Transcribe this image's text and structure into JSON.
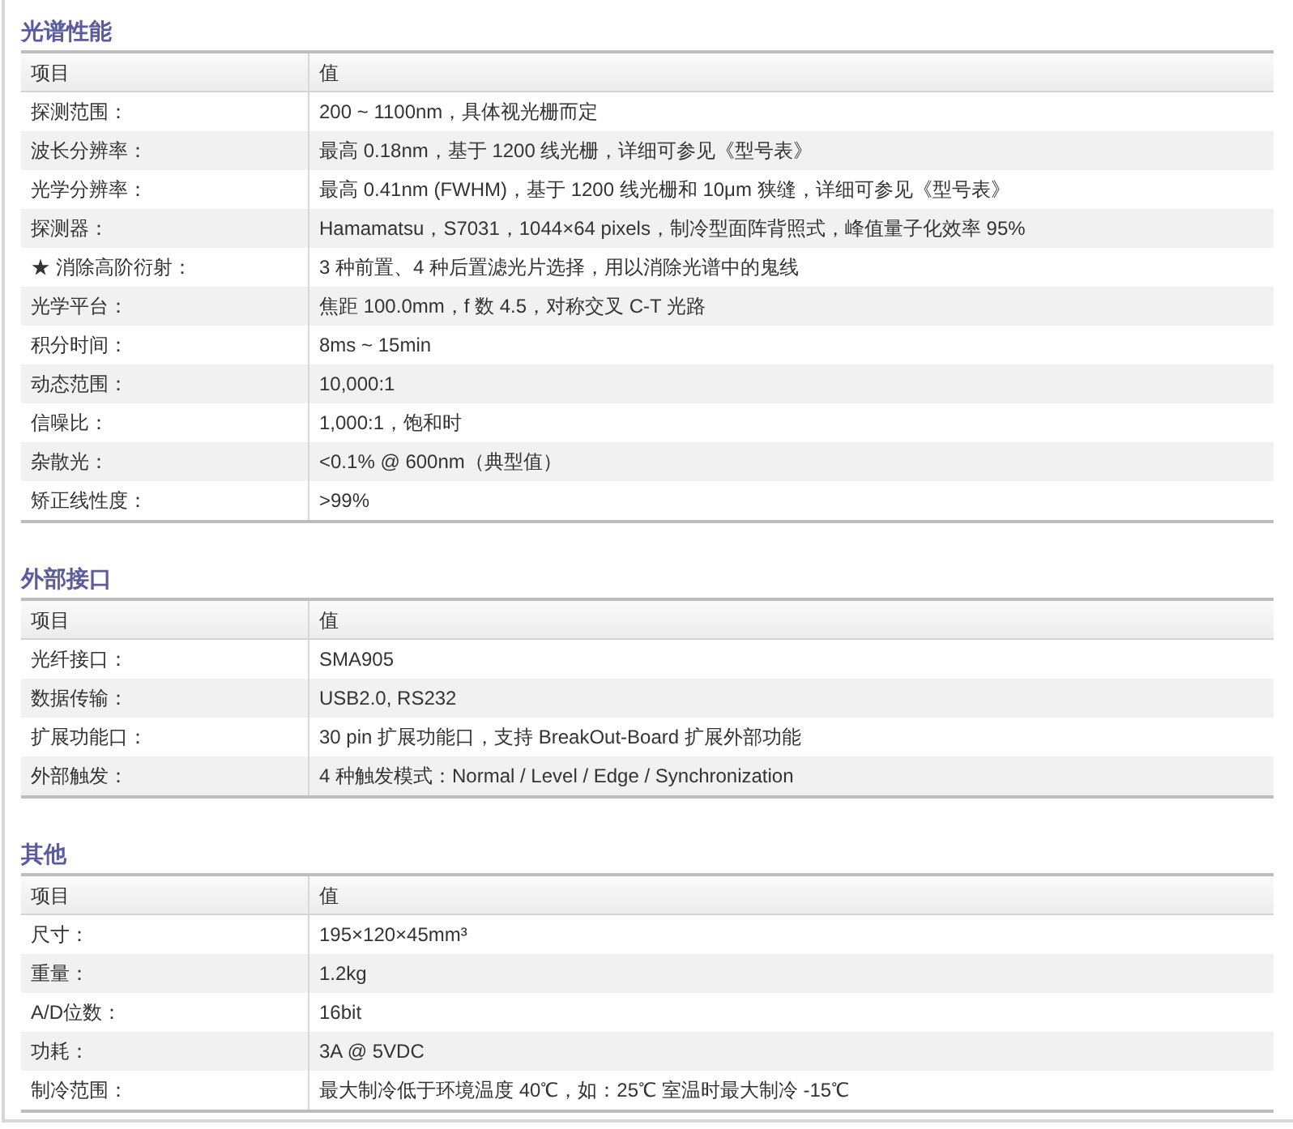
{
  "sections": [
    {
      "title": "光谱性能",
      "columns": [
        "项目",
        "值"
      ],
      "rows": [
        [
          "探测范围：",
          "200 ~ 1100nm，具体视光栅而定"
        ],
        [
          "波长分辨率：",
          "最高 0.18nm，基于 1200 线光栅，详细可参见《型号表》"
        ],
        [
          "光学分辨率：",
          "最高 0.41nm (FWHM)，基于 1200 线光栅和 10μm 狭缝，详细可参见《型号表》"
        ],
        [
          "探测器：",
          "Hamamatsu，S7031，1044×64 pixels，制冷型面阵背照式，峰值量子化效率 95%"
        ],
        [
          "★ 消除高阶衍射：",
          "3 种前置、4 种后置滤光片选择，用以消除光谱中的鬼线"
        ],
        [
          "光学平台：",
          "焦距 100.0mm，f 数 4.5，对称交叉 C-T 光路"
        ],
        [
          "积分时间：",
          "8ms ~ 15min"
        ],
        [
          "动态范围：",
          "10,000:1"
        ],
        [
          "信噪比：",
          "1,000:1，饱和时"
        ],
        [
          "杂散光：",
          "<0.1% @ 600nm（典型值）"
        ],
        [
          "矫正线性度：",
          ">99%"
        ]
      ]
    },
    {
      "title": "外部接口",
      "columns": [
        "项目",
        "值"
      ],
      "rows": [
        [
          "光纤接口：",
          "SMA905"
        ],
        [
          "数据传输：",
          "USB2.0, RS232"
        ],
        [
          "扩展功能口：",
          "30 pin 扩展功能口，支持 BreakOut-Board 扩展外部功能"
        ],
        [
          "外部触发：",
          "4 种触发模式：Normal / Level / Edge / Synchronization"
        ]
      ]
    },
    {
      "title": "其他",
      "columns": [
        "项目",
        "值"
      ],
      "rows": [
        [
          "尺寸：",
          "195×120×45mm³"
        ],
        [
          "重量：",
          "1.2kg"
        ],
        [
          "A/D位数：",
          "16bit"
        ],
        [
          "功耗：",
          "3A @ 5VDC"
        ],
        [
          "制冷范围：",
          "最大制冷低于环境温度 40℃，如：25℃ 室温时最大制冷 -15℃"
        ]
      ]
    }
  ]
}
